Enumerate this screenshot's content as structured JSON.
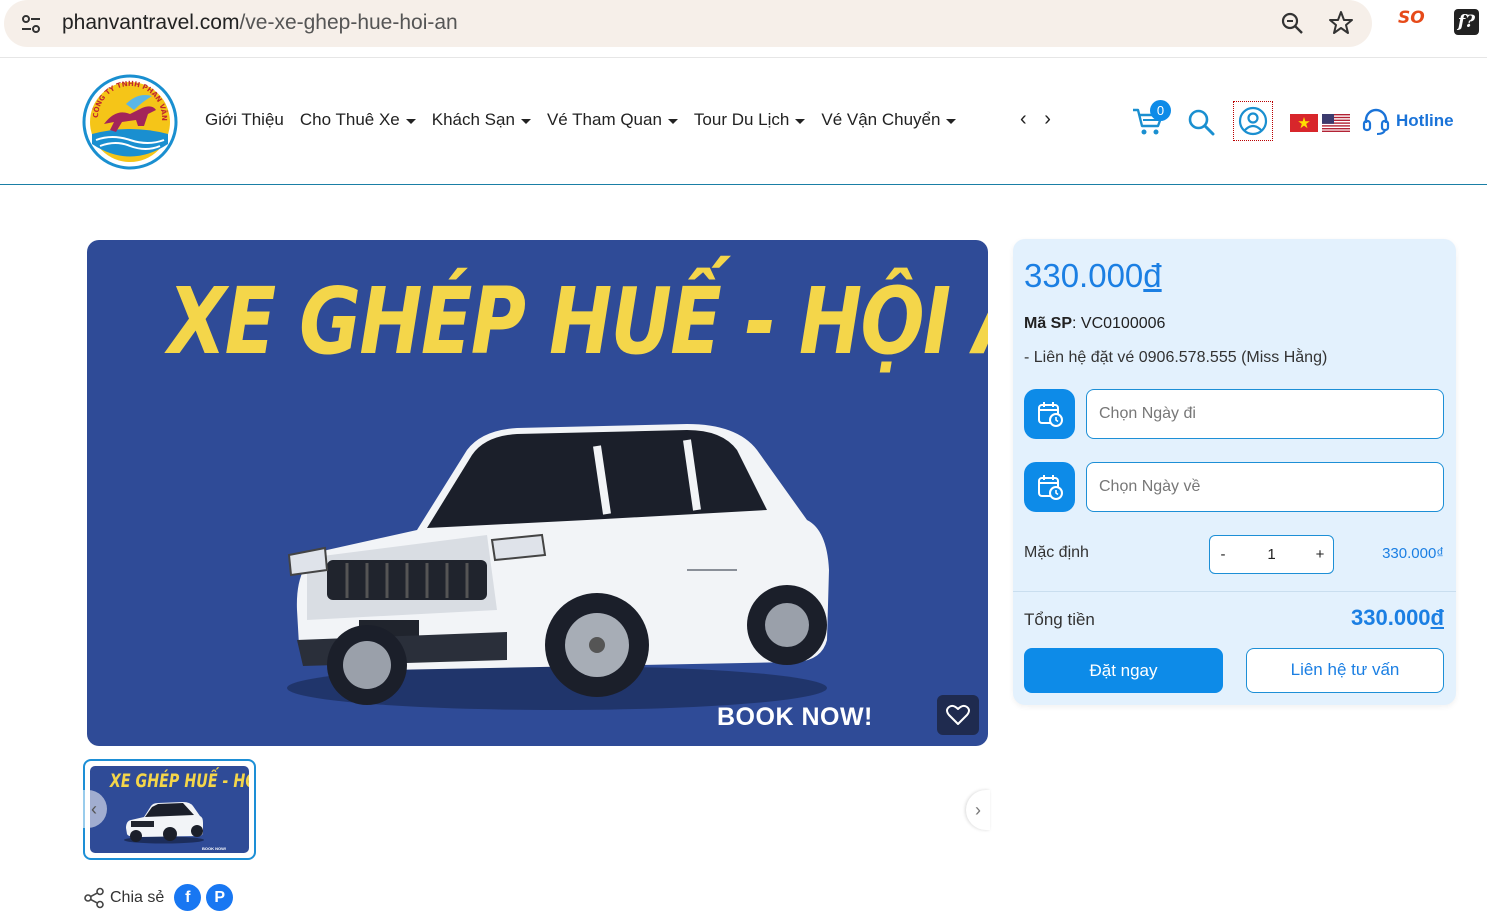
{
  "browser": {
    "url_domain": "phanvantravel.com",
    "url_path": "/ve-xe-ghep-hue-hoi-an",
    "ext1_label": "SO",
    "ext2_label": "f?"
  },
  "header": {
    "nav": [
      {
        "label": "Giới Thiệu",
        "has_caret": false
      },
      {
        "label": "Cho Thuê Xe",
        "has_caret": true
      },
      {
        "label": "Khách Sạn",
        "has_caret": true
      },
      {
        "label": "Vé Tham Quan",
        "has_caret": true
      },
      {
        "label": "Tour Du Lịch",
        "has_caret": true
      },
      {
        "label": "Vé Vận Chuyển",
        "has_caret": true
      }
    ],
    "nav_arrows": "‹ ›",
    "cart_count": "0",
    "hotline": "Hotline",
    "logo_text": "CÔNG TY TNHH PHAN VÂN"
  },
  "hero": {
    "title": "XE GHÉP HUẾ - HỘI AN",
    "book_now": "BOOK NOW!"
  },
  "thumbs": [
    {
      "title": "XE GHÉP HUẾ - HỘI AN",
      "book_now": "BOOK NOW!"
    }
  ],
  "share": {
    "label": "Chia sẻ",
    "facebook": "f",
    "pinterest": "P"
  },
  "panel": {
    "price_number": "330.000",
    "price_currency": "đ",
    "sku_label": "Mã SP",
    "sku_value": ": VC0100006",
    "contact": "- Liên hệ đặt vé 0906.578.555 (Miss Hằng)",
    "depart_placeholder": "Chọn Ngày đi",
    "return_placeholder": "Chọn Ngày về",
    "qty_label": "Mặc định",
    "qty_minus": "-",
    "qty_value": "1",
    "qty_plus": "+",
    "qty_price": "330.000₫",
    "total_label": "Tổng tiền",
    "total_number": "330.000",
    "total_currency": "đ",
    "book_button": "Đặt ngay",
    "contact_button": "Liên hệ tư vấn"
  },
  "colors": {
    "accent": "#0d8be8",
    "hero_bg": "#2f4b97",
    "hero_title": "#f4d64a",
    "panel_bg": "#e3f1fd"
  }
}
